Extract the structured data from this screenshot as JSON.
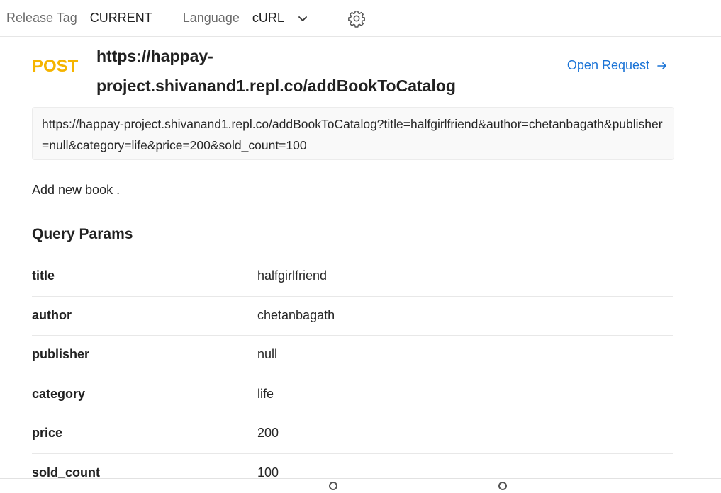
{
  "topbar": {
    "release_label": "Release Tag",
    "release_value": "CURRENT",
    "language_label": "Language",
    "language_value": "cURL",
    "icons": [
      "chevron-down-icon",
      "gear-icon"
    ]
  },
  "request": {
    "method": "POST",
    "url_title": "https://happay-project.shivanand1.repl.co/addBookToCatalog",
    "open_request_label": "Open Request",
    "full_url": "https://happay-project.shivanand1.repl.co/addBookToCatalog?title=halfgirlfriend&author=chetanbagath&publisher=null&category=life&price=200&sold_count=100",
    "description": "Add new book ."
  },
  "query_params": {
    "title": "Query Params",
    "rows": [
      {
        "key": "title",
        "value": "halfgirlfriend"
      },
      {
        "key": "author",
        "value": "chetanbagath"
      },
      {
        "key": "publisher",
        "value": "null"
      },
      {
        "key": "category",
        "value": "life"
      },
      {
        "key": "price",
        "value": "200"
      },
      {
        "key": "sold_count",
        "value": "100"
      }
    ]
  },
  "colors": {
    "method_post": "#f5b400",
    "link": "#1a73d6"
  }
}
